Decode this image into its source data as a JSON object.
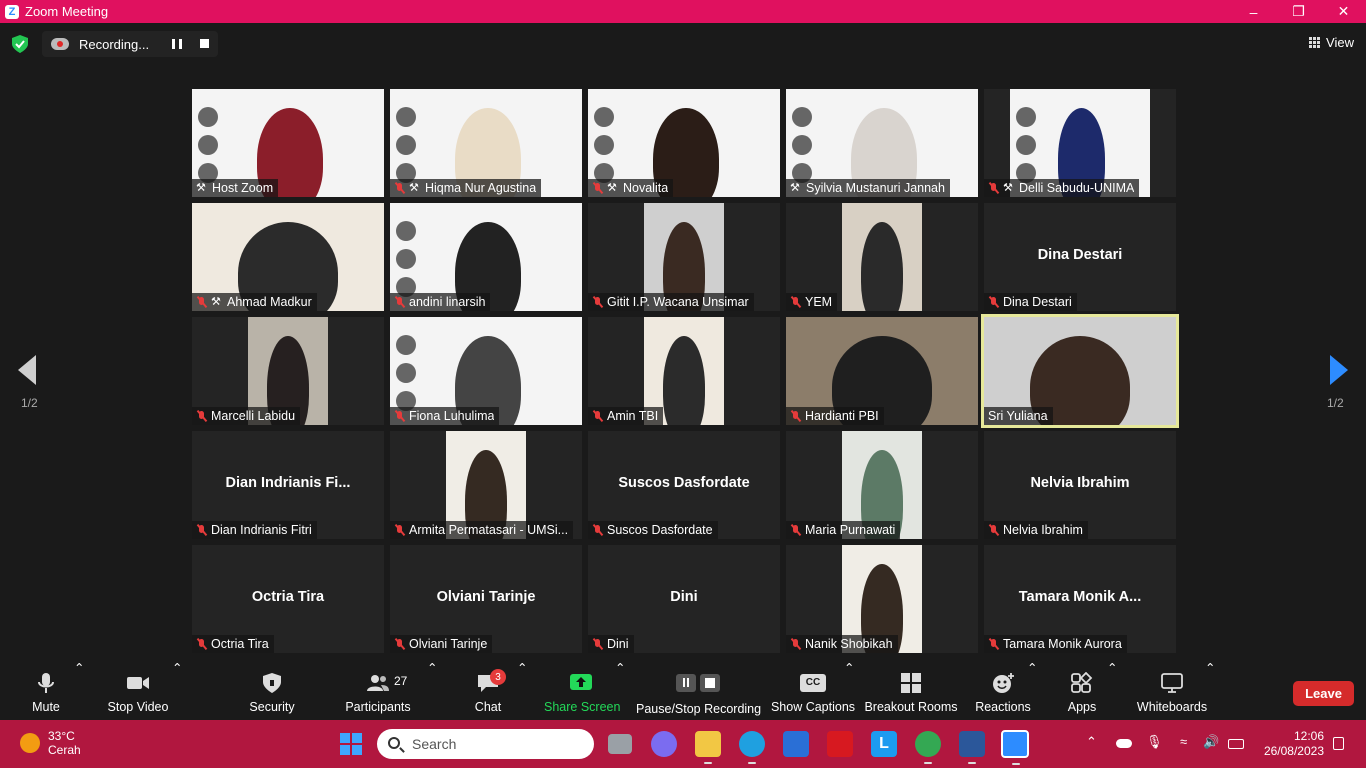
{
  "window": {
    "title": "Zoom Meeting",
    "app_letter": "Z"
  },
  "topbar": {
    "recording_label": "Recording...",
    "view_label": "View"
  },
  "gallery": {
    "page_left": "1/2",
    "page_right": "1/2",
    "tiles": [
      {
        "name": "Host Zoom",
        "muted": false,
        "pinned": true,
        "big": "",
        "kind": "slide"
      },
      {
        "name": "Hiqma Nur Agustina",
        "muted": true,
        "pinned": true,
        "big": "",
        "kind": "slide"
      },
      {
        "name": "Novalita",
        "muted": true,
        "pinned": true,
        "big": "",
        "kind": "slide"
      },
      {
        "name": "Syilvia Mustanuri Jannah",
        "muted": false,
        "pinned": true,
        "big": "",
        "kind": "slide"
      },
      {
        "name": "Delli Sabudu-UNIMA",
        "muted": true,
        "pinned": true,
        "big": "",
        "kind": "slide"
      },
      {
        "name": "Ahmad Madkur",
        "muted": true,
        "pinned": true,
        "big": "",
        "kind": "cam"
      },
      {
        "name": "andini linarsih",
        "muted": true,
        "pinned": false,
        "big": "",
        "kind": "slide"
      },
      {
        "name": "Gitit I.P. Wacana Unsimar",
        "muted": true,
        "pinned": false,
        "big": "",
        "kind": "cam"
      },
      {
        "name": "YEM",
        "muted": true,
        "pinned": false,
        "big": "",
        "kind": "cam"
      },
      {
        "name": "Dina Destari",
        "muted": true,
        "pinned": false,
        "big": "Dina Destari",
        "kind": "none"
      },
      {
        "name": "Marcelli Labidu",
        "muted": true,
        "pinned": false,
        "big": "",
        "kind": "cam"
      },
      {
        "name": "Fiona Luhulima",
        "muted": true,
        "pinned": false,
        "big": "",
        "kind": "slide"
      },
      {
        "name": "Amin TBI",
        "muted": true,
        "pinned": false,
        "big": "",
        "kind": "cam"
      },
      {
        "name": "Hardianti PBI",
        "muted": true,
        "pinned": false,
        "big": "",
        "kind": "cam"
      },
      {
        "name": "Sri Yuliana",
        "muted": false,
        "pinned": false,
        "big": "",
        "kind": "cam",
        "active": true
      },
      {
        "name": "Dian Indrianis Fitri",
        "muted": true,
        "pinned": false,
        "big": "Dian  Indrianis  Fi...",
        "kind": "none"
      },
      {
        "name": "Armita Permatasari - UMSi...",
        "muted": true,
        "pinned": false,
        "big": "",
        "kind": "cam"
      },
      {
        "name": "Suscos Dasfordate",
        "muted": true,
        "pinned": false,
        "big": "Suscos Dasfordate",
        "kind": "none"
      },
      {
        "name": "Maria Purnawati",
        "muted": true,
        "pinned": false,
        "big": "",
        "kind": "cam"
      },
      {
        "name": "Nelvia Ibrahim",
        "muted": true,
        "pinned": false,
        "big": "Nelvia Ibrahim",
        "kind": "none"
      },
      {
        "name": "Octria Tira",
        "muted": true,
        "pinned": false,
        "big": "Octria Tira",
        "kind": "none"
      },
      {
        "name": "Olviani Tarinje",
        "muted": true,
        "pinned": false,
        "big": "Olviani Tarinje",
        "kind": "none"
      },
      {
        "name": "Dini",
        "muted": true,
        "pinned": false,
        "big": "Dini",
        "kind": "none"
      },
      {
        "name": "Nanik Shobikah",
        "muted": true,
        "pinned": false,
        "big": "",
        "kind": "cam"
      },
      {
        "name": "Tamara Monik Aurora",
        "muted": true,
        "pinned": false,
        "big": "Tamara  Monik  A...",
        "kind": "none"
      }
    ]
  },
  "toolbar": {
    "mute": "Mute",
    "stop_video": "Stop Video",
    "security": "Security",
    "participants": "Participants",
    "participants_count": "27",
    "chat": "Chat",
    "chat_badge": "3",
    "share_screen": "Share Screen",
    "pause_stop_recording": "Pause/Stop Recording",
    "show_captions": "Show Captions",
    "captions_badge": "CC",
    "breakout_rooms": "Breakout Rooms",
    "reactions": "Reactions",
    "apps": "Apps",
    "whiteboards": "Whiteboards",
    "leave": "Leave"
  },
  "taskbar": {
    "temperature": "33°C",
    "weather": "Cerah",
    "search_placeholder": "Search",
    "time": "12:06",
    "date": "26/08/2023"
  },
  "colors": {
    "titlebar": "#e0115f",
    "taskbar": "#b1173f",
    "accent_blue": "#2d8cff",
    "share_green": "#23d959",
    "active_speaker": "#e6e89a",
    "leave_red": "#d52b2b"
  }
}
